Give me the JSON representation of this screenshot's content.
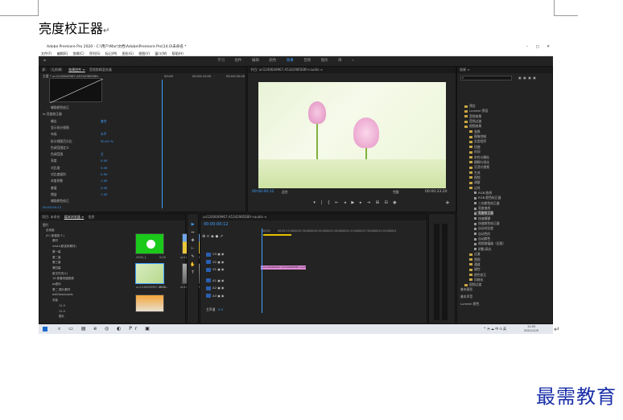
{
  "document": {
    "heading": "亮度校正器",
    "return_mark": "↵",
    "brand": "最需教育"
  },
  "app": {
    "title": "Adobe Premiere Pro 2020 - C:\\用户\\Mar\\文档\\Adobe\\Premiere Pro\\14.0\\未命名 *",
    "window_controls": [
      "–",
      "▢",
      "✕"
    ],
    "menu": [
      "文件(F)",
      "编辑(E)",
      "剪辑(C)",
      "序列(S)",
      "标记(M)",
      "图形(G)",
      "视图(V)",
      "窗口(W)",
      "帮助(H)"
    ],
    "home_icon": "⌂",
    "workspaces": [
      "学习",
      "组件",
      "编辑",
      "颜色",
      "效果",
      "音频",
      "图形",
      "库"
    ],
    "active_workspace": "效果",
    "more_icon": "»"
  },
  "effect_controls": {
    "tabs": [
      "源：（无剪辑）",
      "效果控件 ≡",
      "音频剪辑混合器"
    ],
    "clip_label": "主要 * un1240649967.A5342985E8fr",
    "timecode_a": "00:00",
    "timecode_b": "00:00:15:00",
    "timecode_c": "00:00:30:00",
    "rows": [
      {
        "label": "辅助颜色校正",
        "value": ""
      },
      {
        "label": "fx  亮度校正器",
        "value": ""
      },
      {
        "label": "输出",
        "value": "复合"
      },
      {
        "label": "显示拆分视图",
        "value": ""
      },
      {
        "label": "布局",
        "value": "水平"
      },
      {
        "label": "拆分视图百分比",
        "value": "50.00 %"
      },
      {
        "label": "色调范围定义",
        "value": ""
      },
      {
        "label": "色调范围",
        "value": "主"
      },
      {
        "label": "亮度",
        "value": "0.00"
      },
      {
        "label": "对比度",
        "value": "0.00"
      },
      {
        "label": "对比度级别",
        "value": "0.50"
      },
      {
        "label": "灰度系数",
        "value": "1.00"
      },
      {
        "label": "基值",
        "value": "0.00"
      },
      {
        "label": "增益",
        "value": "1.00"
      },
      {
        "label": "辅助颜色校正",
        "value": ""
      }
    ],
    "footer_time": "00:00:00:12"
  },
  "program": {
    "title": "节目: un1240649967.A5342985E8fr+audio ≡",
    "timecode": "00:00:00:12",
    "fit": "适合",
    "quality": "完整",
    "duration": "00:00:33:20",
    "controls": "▾   |   {   ⇤  ◂  ▶  ▸  ⇥   ⊞  ⊟  ◉",
    "add_icon": "+"
  },
  "project": {
    "tabs": [
      "项目: 未命名",
      "媒体浏览器 ≡",
      "信息"
    ],
    "folder_label": "图片",
    "tree": [
      "此电脑",
      "(F:) 新建卷 5 (",
      "素材",
      "new1(新选择素材)",
      "第一幕",
      "第二幕",
      "第三幕",
      "第四幕",
      "新文件夹(2)",
      "16 新春祝福视频",
      "ps图片",
      "第二 图片素材",
      "bellDownloads",
      "安装",
      "11.0",
      "12.0",
      "图片"
    ],
    "thumbs": [
      {
        "name": "2000_1",
        "dur": "5:00"
      },
      {
        "name": "un1298234546...",
        "dur": "5:00"
      },
      {
        "name": "un1240649967.A534...",
        "dur": "5:00"
      },
      {
        "name": "un1490121466.2A...",
        "dur": "5:00"
      },
      {
        "name": "",
        "dur": ""
      }
    ]
  },
  "timeline": {
    "tab": "un1240649967.A5342985E8fr+audio ≡",
    "timecode": "00:00:00:12",
    "ruler": [
      ":00:00",
      "00:00:15:00",
      "00:00:30:00",
      "00:00:45:00",
      "00:01:00:00",
      "00:01:15:00",
      "00:01:30:00",
      "00:01:45:00",
      "00:0"
    ],
    "tracks": [
      "V3",
      "V2",
      "V1",
      "A1",
      "A2",
      "A3"
    ],
    "master": "主声道",
    "master_value": "0.0",
    "clip_label": "un1240649967.A5342985E8fr+audio",
    "tools": [
      "▶",
      "⇔",
      "✥",
      "⊢",
      "✎",
      "✋",
      "T"
    ]
  },
  "effects": {
    "title": "效果 ≡",
    "search_icon": "⌕",
    "items": [
      {
        "label": "预设",
        "depth": 0,
        "folder": true
      },
      {
        "label": "Lumetri 预设",
        "depth": 0,
        "folder": true
      },
      {
        "label": "音频效果",
        "depth": 0,
        "folder": true
      },
      {
        "label": "音频过渡",
        "depth": 0,
        "folder": true
      },
      {
        "label": "视频效果",
        "depth": 0,
        "folder": true
      },
      {
        "label": "变换",
        "depth": 1,
        "folder": true
      },
      {
        "label": "图像控制",
        "depth": 1,
        "folder": true
      },
      {
        "label": "实用程序",
        "depth": 1,
        "folder": true
      },
      {
        "label": "扭曲",
        "depth": 1,
        "folder": true
      },
      {
        "label": "时间",
        "depth": 1,
        "folder": true
      },
      {
        "label": "杂色与颗粒",
        "depth": 1,
        "folder": true
      },
      {
        "label": "模糊与锐化",
        "depth": 1,
        "folder": true
      },
      {
        "label": "沉浸式视频",
        "depth": 1,
        "folder": true
      },
      {
        "label": "生成",
        "depth": 1,
        "folder": true
      },
      {
        "label": "视频",
        "depth": 1,
        "folder": true
      },
      {
        "label": "调整",
        "depth": 1,
        "folder": true
      },
      {
        "label": "过时",
        "depth": 1,
        "folder": true
      },
      {
        "label": "RGB 曲线",
        "depth": 2,
        "folder": false
      },
      {
        "label": "RGB 颜色校正器",
        "depth": 2,
        "folder": false
      },
      {
        "label": "三向颜色校正器",
        "depth": 2,
        "folder": false
      },
      {
        "label": "亮度曲线",
        "depth": 2,
        "folder": false
      },
      {
        "label": "亮度校正器",
        "depth": 2,
        "folder": false,
        "selected": true
      },
      {
        "label": "快速模糊",
        "depth": 2,
        "folder": false
      },
      {
        "label": "快速颜色校正器",
        "depth": 2,
        "folder": false
      },
      {
        "label": "自动对比度",
        "depth": 2,
        "folder": false
      },
      {
        "label": "自动色阶",
        "depth": 2,
        "folder": false
      },
      {
        "label": "自动颜色",
        "depth": 2,
        "folder": false
      },
      {
        "label": "视频限幅器（旧版）",
        "depth": 2,
        "folder": false
      },
      {
        "label": "阴影/高光",
        "depth": 2,
        "folder": false
      },
      {
        "label": "过渡",
        "depth": 1,
        "folder": true
      },
      {
        "label": "透视",
        "depth": 1,
        "folder": true
      },
      {
        "label": "通道",
        "depth": 1,
        "folder": true
      },
      {
        "label": "键控",
        "depth": 1,
        "folder": true
      },
      {
        "label": "颜色校正",
        "depth": 1,
        "folder": true
      },
      {
        "label": "风格化",
        "depth": 1,
        "folder": true
      },
      {
        "label": "视频过渡",
        "depth": 0,
        "folder": true
      }
    ],
    "sub_panels": [
      "基本图形",
      "基本声音",
      "Lumetri 颜色"
    ]
  },
  "taskbar": {
    "apps": "⌕ ▭ ▤ e ◎ ◐ Pr ▣",
    "time": "11:03",
    "date": "2021/11/5",
    "tray": "^ ◔ ☁ 中 ⊡ 英"
  }
}
